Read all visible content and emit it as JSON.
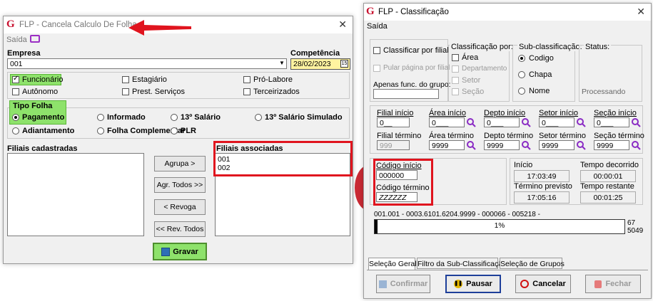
{
  "left": {
    "title": "FLP - Cancela Calculo De Folha",
    "menu_saida": "Saída",
    "empresa_label": "Empresa",
    "empresa_value": "001",
    "competencia_label": "Competência",
    "competencia_value": "28/02/2023",
    "checks": {
      "funcionario": "Funcionário",
      "estagiario": "Estagiário",
      "pro_labore": "Pró-Labore",
      "autonomo": "Autônomo",
      "prest_servicos": "Prest. Serviços",
      "terceirizados": "Terceirizados"
    },
    "tipo_folha_label": "Tipo Folha",
    "radios": {
      "pagamento": "Pagamento",
      "informado": "Informado",
      "salario13": "13º Salário",
      "salario13_simulado": "13º Salário Simulado",
      "adiantamento": "Adiantamento",
      "folha_complementar": "Folha Complementar",
      "plr": "PLR"
    },
    "filiais_cadastradas_label": "Filiais cadastradas",
    "filiais_associadas_label": "Filiais associadas",
    "filiais_associadas": [
      "001",
      "002"
    ],
    "buttons": {
      "agrupa": "Agrupa >",
      "agr_todos": "Agr. Todos >>",
      "revoga": "< Revoga",
      "rev_todos": "<< Rev. Todos",
      "gravar": "Gravar"
    }
  },
  "right": {
    "title": "FLP - Classificação",
    "menu_saida": "Saída",
    "classificar_por_filial": "Classificar por filial",
    "pular_pagina": "Pular página por filial",
    "apenas_func_label": "Apenas func. do grupo:",
    "classificacao_label": "Classificação  por:",
    "classificacao_opts": [
      "Área",
      "Departamento",
      "Setor",
      "Seção"
    ],
    "subclass_label": "Sub-classificação:",
    "subclass_opts": [
      "Codigo",
      "Chapa",
      "Nome"
    ],
    "status_label": "Status:",
    "status_value": "Processando",
    "filial_inicio_label": "Filial início",
    "filial_inicio_value": "0__",
    "filial_termino_label": "Filial término",
    "filial_termino_value": "999",
    "area_inicio_label": "Área início",
    "area_inicio_value": "0___",
    "area_termino_label": "Área término",
    "area_termino_value": "9999",
    "depto_inicio_label": "Depto início",
    "depto_inicio_value": "0___",
    "depto_termino_label": "Depto término",
    "depto_termino_value": "9999",
    "setor_inicio_label": "Setor início",
    "setor_inicio_value": "0___",
    "setor_termino_label": "Setor término",
    "setor_termino_value": "9999",
    "secao_inicio_label": "Seção início",
    "secao_inicio_value": "0___",
    "secao_termino_label": "Seção término",
    "secao_termino_value": "9999",
    "codigo_inicio_label": "Código início",
    "codigo_inicio_value": "000000",
    "codigo_termino_label": "Código término",
    "codigo_termino_value": "ZZZZZZ",
    "inicio_label": "Início",
    "inicio_value": "17:03:49",
    "tempo_decorrido_label": "Tempo decorrido",
    "tempo_decorrido_value": "00:00:01",
    "termino_previsto_label": "Término previsto",
    "termino_previsto_value": "17:05:16",
    "tempo_restante_label": "Tempo restante",
    "tempo_restante_value": "00:01:25",
    "progress_text": "001.001 - 0003.6101.6204.9999 - 000066 - 005218 -",
    "progress_percent": "1%",
    "progress_fraction": 0.01,
    "counter_current": "67",
    "counter_total": "5049",
    "tabs": [
      "Seleção Geral",
      "Filtro da Sub-Classificação",
      "Seleção de Grupos"
    ],
    "buttons": {
      "confirmar": "Confirmar",
      "pausar": "Pausar",
      "cancelar": "Cancelar",
      "fechar": "Fechar"
    }
  },
  "colors": {
    "highlight_red": "#e0141e",
    "highlight_green": "#8ee26b",
    "competencia_bg": "#fff3a0",
    "brand": "#c8102e"
  }
}
